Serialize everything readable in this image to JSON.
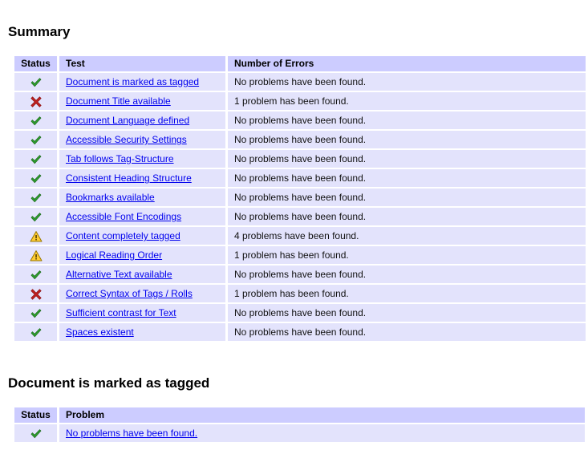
{
  "colors": {
    "header_bg": "#ccccff",
    "row_bg": "#e3e3fc",
    "link": "#0000ee",
    "ok": "#2f9e2f",
    "error": "#c02020",
    "warning": "#ffcc33",
    "page_bg": "#ffffff",
    "text": "#000000"
  },
  "summary": {
    "heading": "Summary",
    "columns": {
      "status": "Status",
      "test": "Test",
      "errors": "Number of Errors"
    },
    "rows": [
      {
        "status_icon": "check-icon",
        "status": "pass",
        "test": "Document is marked as tagged",
        "errors": "No problems have been found."
      },
      {
        "status_icon": "cross-icon",
        "status": "fail",
        "test": "Document Title available",
        "errors": "1 problem has been found."
      },
      {
        "status_icon": "check-icon",
        "status": "pass",
        "test": "Document Language defined",
        "errors": "No problems have been found."
      },
      {
        "status_icon": "check-icon",
        "status": "pass",
        "test": "Accessible Security Settings",
        "errors": "No problems have been found."
      },
      {
        "status_icon": "check-icon",
        "status": "pass",
        "test": "Tab follows Tag-Structure",
        "errors": "No problems have been found."
      },
      {
        "status_icon": "check-icon",
        "status": "pass",
        "test": "Consistent Heading Structure",
        "errors": "No problems have been found."
      },
      {
        "status_icon": "check-icon",
        "status": "pass",
        "test": "Bookmarks available",
        "errors": "No problems have been found."
      },
      {
        "status_icon": "check-icon",
        "status": "pass",
        "test": "Accessible Font Encodings",
        "errors": "No problems have been found."
      },
      {
        "status_icon": "warning-icon",
        "status": "warning",
        "test": "Content completely tagged",
        "errors": "4 problems have been found."
      },
      {
        "status_icon": "warning-icon",
        "status": "warning",
        "test": "Logical Reading Order",
        "errors": "1 problem has been found."
      },
      {
        "status_icon": "check-icon",
        "status": "pass",
        "test": "Alternative Text available",
        "errors": "No problems have been found."
      },
      {
        "status_icon": "cross-icon",
        "status": "fail",
        "test": "Correct Syntax of Tags / Rolls",
        "errors": "1 problem has been found."
      },
      {
        "status_icon": "check-icon",
        "status": "pass",
        "test": "Sufficient contrast for Text",
        "errors": "No problems have been found."
      },
      {
        "status_icon": "check-icon",
        "status": "pass",
        "test": "Spaces existent",
        "errors": "No problems have been found."
      }
    ]
  },
  "detail": {
    "heading": "Document is marked as tagged",
    "columns": {
      "status": "Status",
      "problem": "Problem"
    },
    "rows": [
      {
        "status_icon": "check-icon",
        "status": "pass",
        "problem": "No problems have been found."
      }
    ]
  }
}
